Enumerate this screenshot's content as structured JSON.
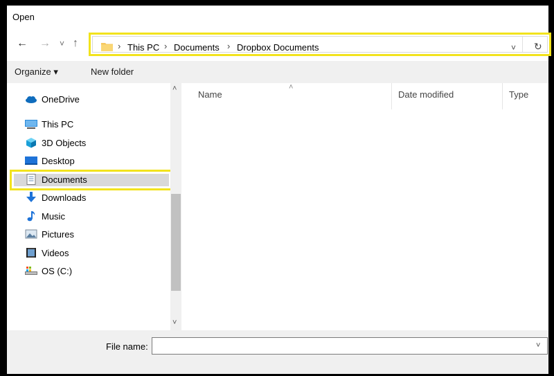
{
  "window": {
    "title": "Open"
  },
  "nav": {
    "back_glyph": "←",
    "forward_glyph": "→",
    "recent_glyph": "˅",
    "up_glyph": "↑",
    "breadcrumb": [
      "This PC",
      "Documents",
      "Dropbox Documents"
    ],
    "separator": "›",
    "dropdown_glyph": "˅",
    "refresh_glyph": "↻"
  },
  "toolbar": {
    "organize_label": "Organize ▾",
    "new_folder_label": "New folder"
  },
  "sidebar": {
    "items": [
      {
        "label": "OneDrive",
        "icon": "cloud-icon"
      },
      {
        "label": "This PC",
        "icon": "computer-icon"
      },
      {
        "label": "3D Objects",
        "icon": "cube-icon"
      },
      {
        "label": "Desktop",
        "icon": "desktop-icon"
      },
      {
        "label": "Documents",
        "icon": "document-icon",
        "selected": true
      },
      {
        "label": "Downloads",
        "icon": "download-arrow-icon"
      },
      {
        "label": "Music",
        "icon": "music-note-icon"
      },
      {
        "label": "Pictures",
        "icon": "picture-icon"
      },
      {
        "label": "Videos",
        "icon": "video-icon"
      },
      {
        "label": "OS (C:)",
        "icon": "drive-icon"
      }
    ],
    "scroll_up_glyph": "˄",
    "scroll_down_glyph": "˅"
  },
  "columns": [
    "Name",
    "Date modified",
    "Type"
  ],
  "sort_indicator": "˄",
  "footer": {
    "file_name_label": "File name:",
    "file_name_value": "",
    "dropdown_glyph": "˅"
  },
  "colors": {
    "highlight": "#f2e31c",
    "selected_bg": "#d9d9d9",
    "folder": "#f6c85f",
    "accent": "#1e73d8"
  }
}
